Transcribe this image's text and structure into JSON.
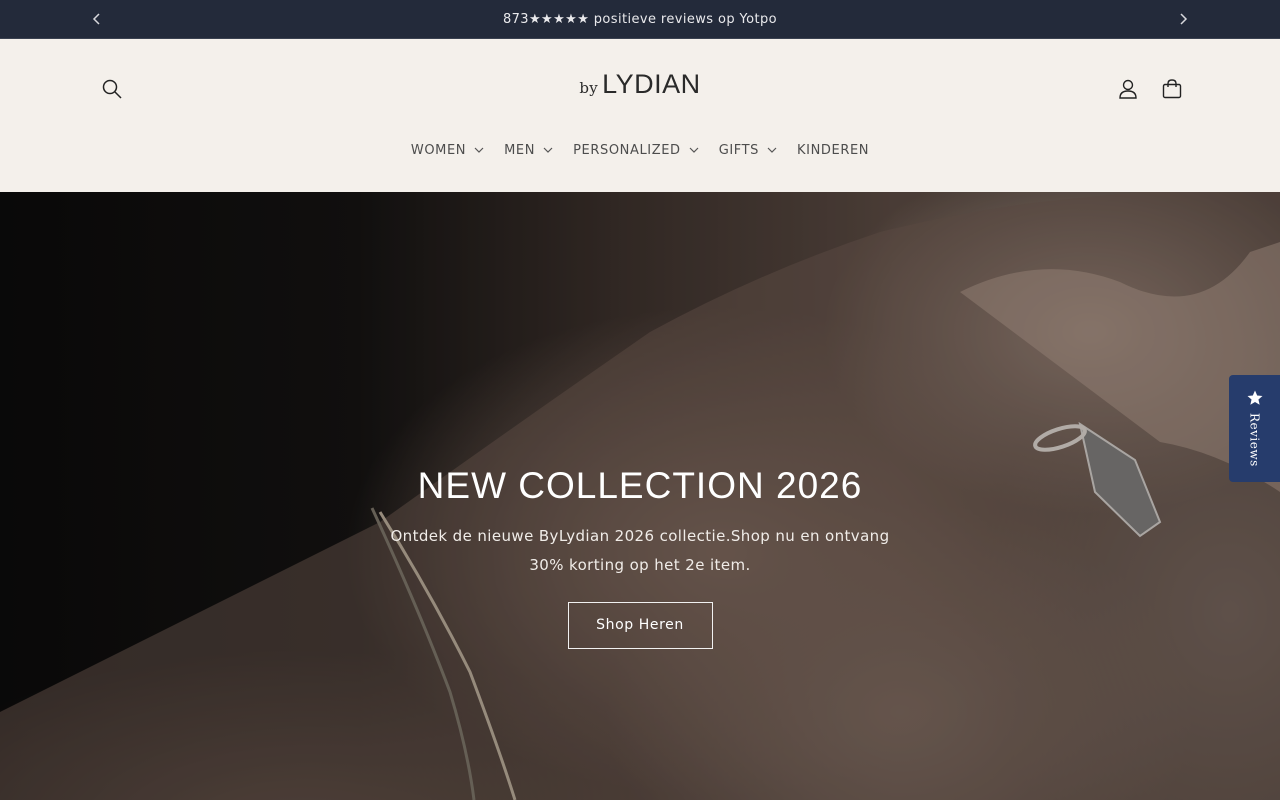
{
  "announcement": {
    "text": "873★★★★★ positieve reviews op Yotpo",
    "prev_icon": "chevron-left-icon",
    "next_icon": "chevron-right-icon"
  },
  "header": {
    "logo_small": "by",
    "logo_main": "LYDIAN",
    "icons": [
      "search-icon",
      "account-icon",
      "cart-icon"
    ]
  },
  "nav": {
    "items": [
      {
        "label": "WOMEN",
        "has_dropdown": true
      },
      {
        "label": "MEN",
        "has_dropdown": true
      },
      {
        "label": "PERSONALIZED",
        "has_dropdown": true
      },
      {
        "label": "GIFTS",
        "has_dropdown": true
      },
      {
        "label": "KINDEREN",
        "has_dropdown": false
      }
    ]
  },
  "hero": {
    "title": "NEW COLLECTION 2026",
    "subtitle": "Ontdek de nieuwe ByLydian 2026 collectie.Shop nu en ontvang 30% korting op het 2e item.",
    "button_label": "Shop Heren"
  },
  "reviews_tab": {
    "label": "Reviews",
    "icon": "star-icon",
    "color": "#263c6c"
  },
  "colors": {
    "announcement_bg": "#232a3a",
    "header_bg": "#f4f0eb",
    "text": "#4d4d4d"
  }
}
